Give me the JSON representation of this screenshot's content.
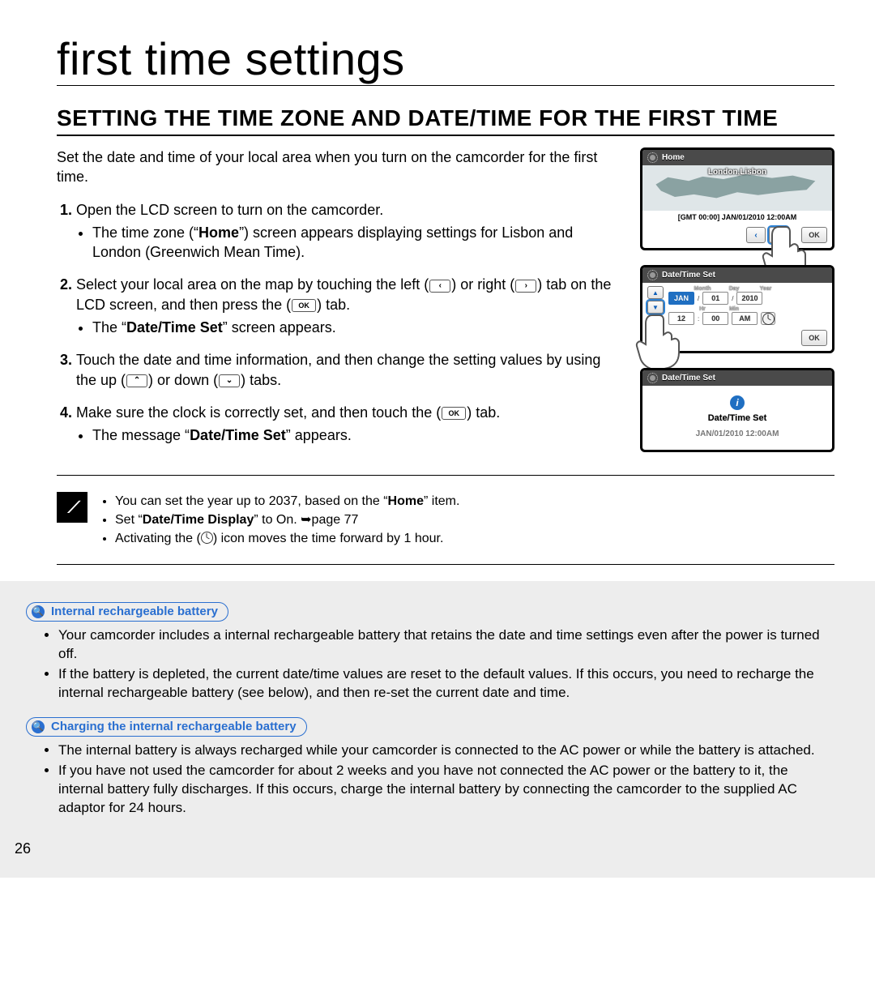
{
  "page": {
    "number": "26",
    "title": "first time settings",
    "section_heading": "SETTING THE TIME ZONE AND DATE/TIME FOR THE FIRST TIME",
    "intro": "Set the date and time of your local area when you turn on the camcorder for the first time."
  },
  "steps": [
    {
      "text": "Open the LCD screen to turn on the camcorder.",
      "sub_pre": "The time zone (“",
      "sub_bold": "Home",
      "sub_post": "”) screen appears displaying settings for Lisbon and London (Greenwich Mean Time)."
    },
    {
      "text_pre": "Select your local area on the map by touching the left (",
      "text_mid1": ") or right (",
      "text_mid2": ") tab on the LCD screen, and then press the (",
      "text_post": ") tab.",
      "sub_pre": "The “",
      "sub_bold": "Date/Time Set",
      "sub_post": "” screen appears."
    },
    {
      "text_pre": "Touch the date and time information, and then change the setting values by using the up (",
      "text_mid": ") or down (",
      "text_post": ") tabs."
    },
    {
      "text_pre": "Make sure the clock is correctly set, and then touch the (",
      "text_post": ") tab.",
      "sub_pre": "The message “",
      "sub_bold": "Date/Time Set",
      "sub_post": "” appears."
    }
  ],
  "inline_buttons": {
    "left": "‹",
    "right": "›",
    "up": "⌃",
    "down": "⌄",
    "ok": "OK"
  },
  "figures": {
    "home": {
      "header": "Home",
      "city": "London,Lisbon",
      "gmt": "[GMT 00:00] JAN/01/2010 12:00AM",
      "ok": "OK"
    },
    "datetime": {
      "header": "Date/Time Set",
      "labels_top": {
        "month": "Month",
        "day": "Day",
        "year": "Year"
      },
      "labels_bot": {
        "hr": "Hr",
        "min": "Min"
      },
      "month": "JAN",
      "day": "01",
      "year": "2010",
      "hr": "12",
      "min": "00",
      "ampm": "AM",
      "ok": "OK"
    },
    "confirm": {
      "header": "Date/Time Set",
      "title": "Date/Time Set",
      "value": "JAN/01/2010 12:00AM"
    }
  },
  "notes": [
    {
      "pre": "You can set the year up to 2037, based on the “",
      "bold": "Home",
      "post": "” item."
    },
    {
      "pre": "Set “",
      "bold": "Date/Time Display",
      "post": "” to On. ➥page 77"
    },
    {
      "pre": "Activating the (",
      "icon": "dst",
      "post": ") icon moves the time forward by 1 hour."
    }
  ],
  "info": {
    "topic1": "Internal rechargeable battery",
    "topic1_items": [
      "Your camcorder includes a internal rechargeable battery that retains the date and time settings even after the power is turned off.",
      "If the battery is depleted, the current date/time values are reset to the default values. If this occurs, you need to recharge the internal rechargeable battery (see below), and then re-set the current date and time."
    ],
    "topic2": "Charging the internal rechargeable battery",
    "topic2_items": [
      "The internal battery is always recharged while your camcorder is connected to the AC power or while the battery is attached.",
      "If you have not used the camcorder for about 2 weeks and you have not connected the AC power or the battery to it, the internal battery fully discharges. If this occurs, charge the internal battery by connecting the camcorder to the supplied AC adaptor for 24 hours."
    ]
  }
}
